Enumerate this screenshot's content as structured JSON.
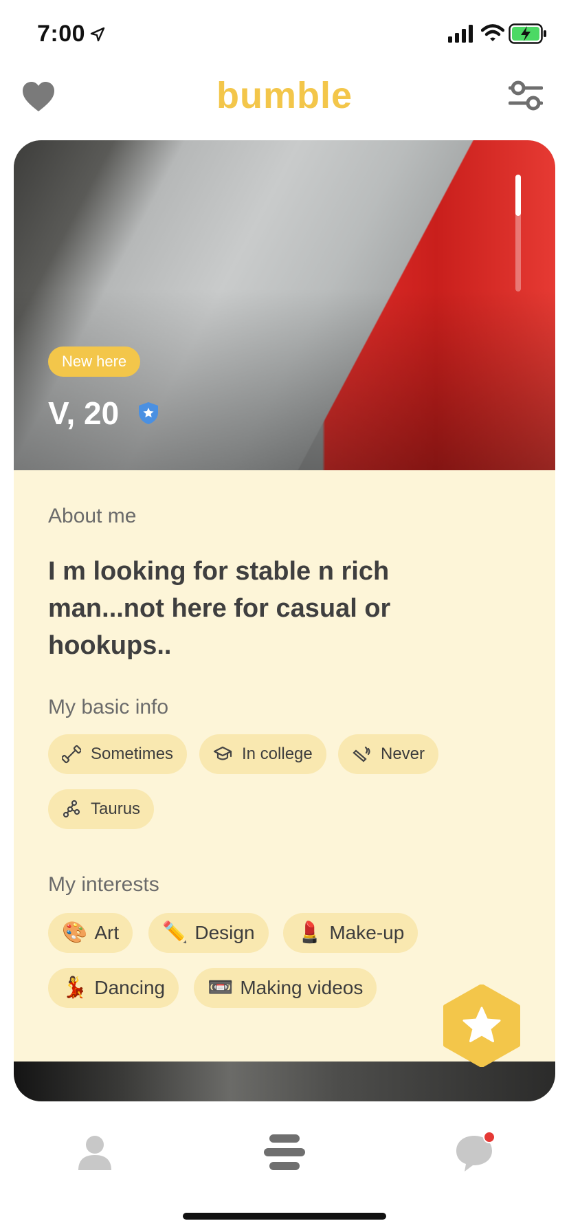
{
  "status_bar": {
    "time": "7:00"
  },
  "header": {
    "title": "bumble"
  },
  "profile": {
    "badge": "New here",
    "name_age": "V, 20",
    "about_label": "About me",
    "about_text": "I m looking for stable n rich man...not here for casual or hookups..",
    "basic_info_label": "My basic info",
    "basic_info": [
      {
        "label": "Sometimes",
        "icon": "dumbbell-icon"
      },
      {
        "label": "In college",
        "icon": "graduation-cap-icon"
      },
      {
        "label": "Never",
        "icon": "smoking-icon"
      },
      {
        "label": "Taurus",
        "icon": "constellation-icon"
      }
    ],
    "interests_label": "My interests",
    "interests": [
      {
        "label": "Art",
        "emoji": "🎨"
      },
      {
        "label": "Design",
        "emoji": "✏️"
      },
      {
        "label": "Make-up",
        "emoji": "💄"
      },
      {
        "label": "Dancing",
        "emoji": "💃"
      },
      {
        "label": "Making videos",
        "emoji": "📼"
      }
    ]
  },
  "colors": {
    "brand": "#f3c64a",
    "card_background": "#fdf5d8",
    "chip_background": "#f9e8b0",
    "verified": "#4a90e2",
    "notification": "#e53935"
  }
}
